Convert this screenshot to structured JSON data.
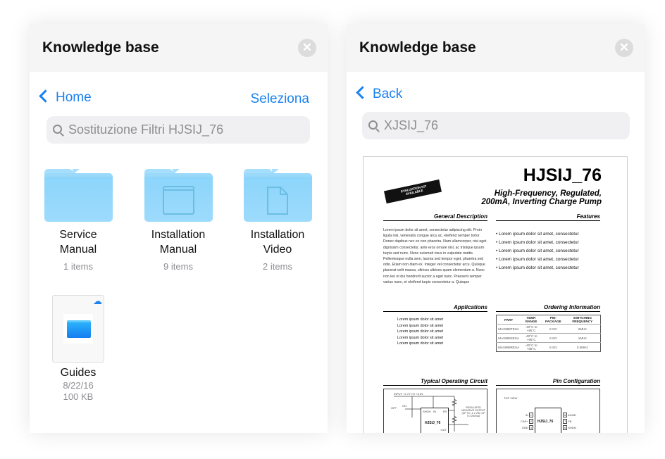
{
  "left_panel": {
    "title": "Knowledge base",
    "back_label": "Home",
    "select_label": "Seleziona",
    "search_placeholder": "Sostituzione Filtri HJSIJ_76",
    "items": [
      {
        "name_line1": "Service",
        "name_line2": "Manual",
        "meta": "1 items",
        "icon": "folder-icon"
      },
      {
        "name_line1": "Installation",
        "name_line2": "Manual",
        "meta": "9 items",
        "icon": "folder-window-icon"
      },
      {
        "name_line1": "Installation",
        "name_line2": "Video",
        "meta": "2 items",
        "icon": "folder-document-icon"
      },
      {
        "name_line1": "Guides",
        "date": "8/22/16",
        "size": "100 KB",
        "icon": "file-folder-icon",
        "badge": "cloud-download-icon"
      }
    ]
  },
  "right_panel": {
    "title": "Knowledge base",
    "back_label": "Back",
    "search_value": "XJSIJ_76",
    "document": {
      "part": "HJSIJ_76",
      "badge": "EVALUATION KIT AVAILABLE",
      "subtitle1": "High-Frequency, Regulated,",
      "subtitle2": "200mA, Inverting Charge Pump",
      "general_description_heading": "General Description",
      "general_description": "Lorem ipsum dolor sit amet, consectetur adipiscing elit. Proin ligula nisi, venenatis congue arcu ac, eleifend semper tortor. Donec dapibus nec ex non pharetra. Nam ullamcorper, nisi eget dignissim consectetur, ante eros ornare nisl, ac tristique ipsum turpis sed nunc. Nunc euismod risus in vulputate mattis. Pellentesque nulla sem, lacinia sed tempor eget, pharetra sed odio. Etiam non diam ex. Integer vel consectetur arcu. Quisque placerat velit massa, ultrices ultrices quam elementum a. Nunc non leo et dui hendrerit auctor a eget nunc. Praesent semper varius nunc, et eleifend turpis consectetur a. Quisque",
      "features_heading": "Features",
      "features": [
        "Lorem ipsum dolor sit amet, consectetur",
        "Lorem ipsum dolor sit amet, consectetur",
        "Lorem ipsum dolor sit amet, consectetur",
        "Lorem ipsum dolor sit amet, consectetur",
        "Lorem ipsum dolor sit amet, consectetur"
      ],
      "applications_heading": "Applications",
      "applications": [
        "Lorem ipsum dolor sit amet",
        "Lorem ipsum dolor sit amet",
        "Lorem ipsum dolor sit amet",
        "Lorem ipsum dolor sit amet",
        "Lorem ipsum dolor sit amet"
      ],
      "ordering_heading": "Ordering Information",
      "ordering_columns": [
        "PART",
        "TEMP. RANGE",
        "PIN-PACKAGE",
        "SWITCHING FREQUENCY"
      ],
      "ordering_rows": [
        [
          "MAX889TESA",
          "-40°C to +85°C",
          "8 SO",
          "2MHz"
        ],
        [
          "MAX889SESA",
          "-40°C to +85°C",
          "8 SO",
          "1MHz"
        ],
        [
          "MAX889RESA",
          "-40°C to +85°C",
          "8 SO",
          "0.5MHz"
        ]
      ],
      "circuit_heading": "Typical Operating Circuit",
      "circuit": {
        "input": "INPUT +2.7V TO +5.5V",
        "off": "OFF",
        "on": "ON",
        "chip": "HJSIJ_76",
        "shdn": "SHDN",
        "in": "IN",
        "fb": "FB",
        "out": "OUT",
        "output": "REGULATED NEGATIVE OUTPUT (UP TO -1 x VIN, UP TO 200mA)"
      },
      "pin_heading": "Pin Configuration",
      "pins": {
        "top_view": "TOP VIEW",
        "chip": "HJSIJ_76",
        "left": [
          "IN",
          "CAP+",
          "GND"
        ],
        "right": [
          "AGND",
          "FB",
          "SHDN"
        ],
        "left_nums": [
          "1",
          "2",
          "3"
        ],
        "right_nums": [
          "8",
          "7",
          "6"
        ]
      }
    }
  },
  "colors": {
    "accent": "#1a82f0",
    "folder": "#8cd5fb",
    "header_bg": "#f5f5f5"
  }
}
